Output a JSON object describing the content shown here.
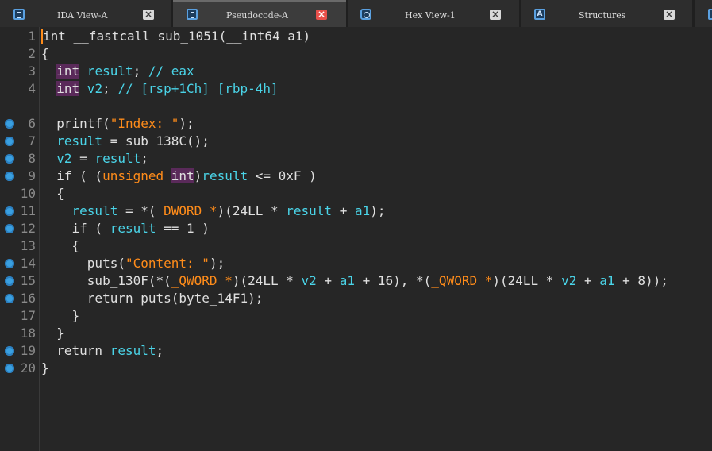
{
  "tabs": [
    {
      "label": "IDA View-A",
      "icon": "doc-icon",
      "active": false
    },
    {
      "label": "Pseudocode-A",
      "icon": "doc-icon",
      "active": true
    },
    {
      "label": "Hex View-1",
      "icon": "hex-icon",
      "active": false
    },
    {
      "label": "Structures",
      "icon": "struct-icon",
      "active": false
    }
  ],
  "colors": {
    "background": "#262626",
    "variable": "#4ad4e8",
    "string": "#ff8c1a",
    "breakpoint": "#3aa0e0",
    "type_highlight": "#5a2a5a",
    "active_close": "#e8504b"
  },
  "lines": [
    {
      "n": "1",
      "bp": false,
      "tokens": [
        [
          "kw",
          "int"
        ],
        [
          "pl",
          " __fastcall sub_1051(__int64 a1)"
        ]
      ]
    },
    {
      "n": "2",
      "bp": false,
      "tokens": [
        [
          "pl",
          "{"
        ]
      ]
    },
    {
      "n": "3",
      "bp": false,
      "tokens": [
        [
          "pl",
          "  "
        ],
        [
          "type",
          "int"
        ],
        [
          "var",
          " result"
        ],
        [
          "pl",
          "; "
        ],
        [
          "cm",
          "// eax"
        ]
      ]
    },
    {
      "n": "4",
      "bp": false,
      "tokens": [
        [
          "pl",
          "  "
        ],
        [
          "type",
          "int"
        ],
        [
          "var",
          " v2"
        ],
        [
          "pl",
          "; "
        ],
        [
          "cm",
          "// [rsp+1Ch] [rbp-4h]"
        ]
      ]
    },
    {
      "n": "",
      "bp": false,
      "tokens": []
    },
    {
      "n": "6",
      "bp": true,
      "tokens": [
        [
          "pl",
          "  printf("
        ],
        [
          "str",
          "\"Index: \""
        ],
        [
          "pl",
          ");"
        ]
      ]
    },
    {
      "n": "7",
      "bp": true,
      "tokens": [
        [
          "pl",
          "  "
        ],
        [
          "var",
          "result"
        ],
        [
          "pl",
          " = sub_138C();"
        ]
      ]
    },
    {
      "n": "8",
      "bp": true,
      "tokens": [
        [
          "pl",
          "  "
        ],
        [
          "var",
          "v2"
        ],
        [
          "pl",
          " = "
        ],
        [
          "var",
          "result"
        ],
        [
          "pl",
          ";"
        ]
      ]
    },
    {
      "n": "9",
      "bp": true,
      "tokens": [
        [
          "pl",
          "  if ( ("
        ],
        [
          "cast",
          "unsigned "
        ],
        [
          "type",
          "int"
        ],
        [
          "pl",
          ")"
        ],
        [
          "var",
          "result"
        ],
        [
          "pl",
          " <= 0xF )"
        ]
      ]
    },
    {
      "n": "10",
      "bp": false,
      "tokens": [
        [
          "pl",
          "  {"
        ]
      ]
    },
    {
      "n": "11",
      "bp": true,
      "tokens": [
        [
          "pl",
          "    "
        ],
        [
          "var",
          "result"
        ],
        [
          "pl",
          " = *("
        ],
        [
          "cast",
          "_DWORD *"
        ],
        [
          "pl",
          ")(24LL * "
        ],
        [
          "var",
          "result"
        ],
        [
          "pl",
          " + "
        ],
        [
          "var",
          "a1"
        ],
        [
          "pl",
          ");"
        ]
      ]
    },
    {
      "n": "12",
      "bp": true,
      "tokens": [
        [
          "pl",
          "    if ( "
        ],
        [
          "var",
          "result"
        ],
        [
          "pl",
          " == 1 )"
        ]
      ]
    },
    {
      "n": "13",
      "bp": false,
      "tokens": [
        [
          "pl",
          "    {"
        ]
      ]
    },
    {
      "n": "14",
      "bp": true,
      "tokens": [
        [
          "pl",
          "      puts("
        ],
        [
          "str",
          "\"Content: \""
        ],
        [
          "pl",
          ");"
        ]
      ]
    },
    {
      "n": "15",
      "bp": true,
      "tokens": [
        [
          "pl",
          "      sub_130F(*("
        ],
        [
          "cast",
          "_QWORD *"
        ],
        [
          "pl",
          ")(24LL * "
        ],
        [
          "var",
          "v2"
        ],
        [
          "pl",
          " + "
        ],
        [
          "var",
          "a1"
        ],
        [
          "pl",
          " + 16), *("
        ],
        [
          "cast",
          "_QWORD *"
        ],
        [
          "pl",
          ")(24LL * "
        ],
        [
          "var",
          "v2"
        ],
        [
          "pl",
          " + "
        ],
        [
          "var",
          "a1"
        ],
        [
          "pl",
          " + 8));"
        ]
      ]
    },
    {
      "n": "16",
      "bp": true,
      "tokens": [
        [
          "pl",
          "      return puts(byte_14F1);"
        ]
      ]
    },
    {
      "n": "17",
      "bp": false,
      "tokens": [
        [
          "pl",
          "    }"
        ]
      ]
    },
    {
      "n": "18",
      "bp": false,
      "tokens": [
        [
          "pl",
          "  }"
        ]
      ]
    },
    {
      "n": "19",
      "bp": true,
      "tokens": [
        [
          "pl",
          "  return "
        ],
        [
          "var",
          "result"
        ],
        [
          "pl",
          ";"
        ]
      ]
    },
    {
      "n": "20",
      "bp": true,
      "tokens": [
        [
          "pl",
          "}"
        ]
      ]
    }
  ]
}
